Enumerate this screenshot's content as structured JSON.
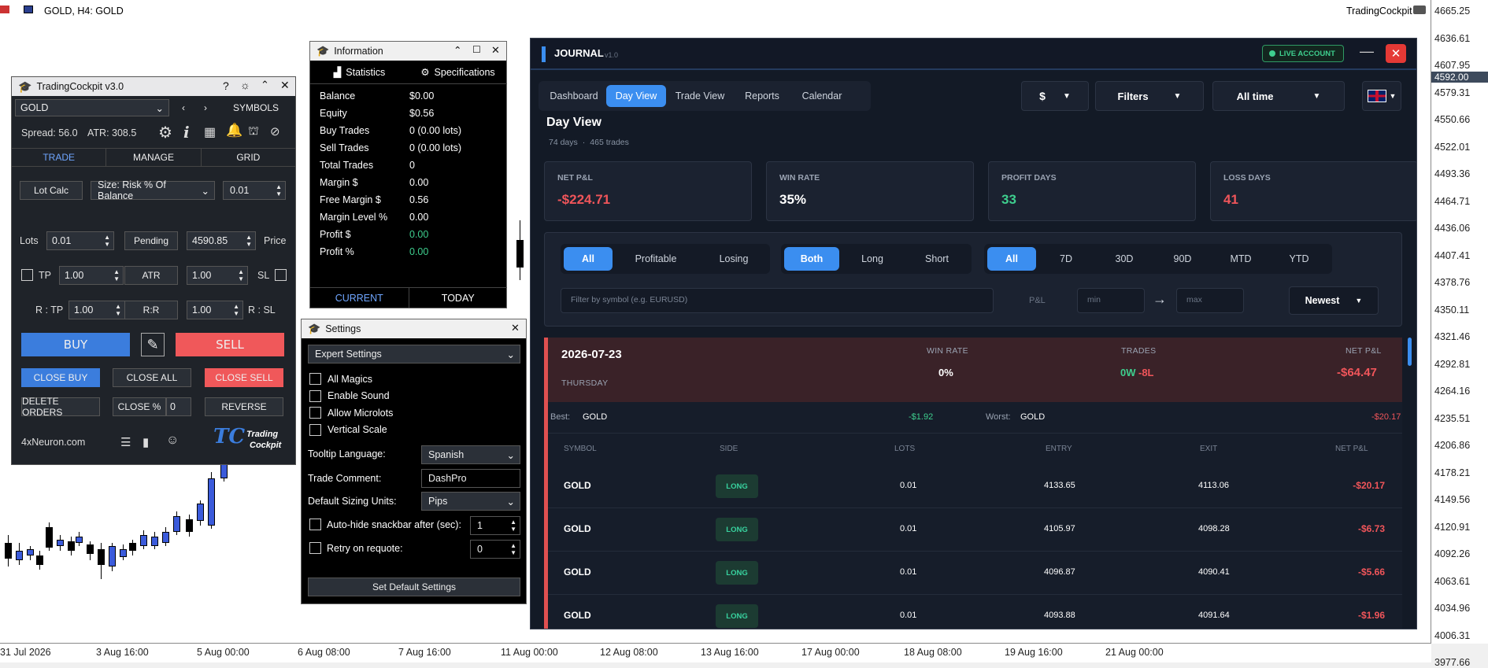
{
  "chart": {
    "symbol": "GOLD, H4:  GOLD",
    "brand": "TradingCockpit",
    "current_price": "4592.00",
    "price_ticks": [
      "4665.25",
      "4636.61",
      "4607.95",
      "4579.31",
      "4550.66",
      "4522.01",
      "4493.36",
      "4464.71",
      "4436.06",
      "4407.41",
      "4378.76",
      "4350.11",
      "4321.46",
      "4292.81",
      "4264.16",
      "4235.51",
      "4206.86",
      "4178.21",
      "4149.56",
      "4120.91",
      "4092.26",
      "4063.61",
      "4034.96",
      "4006.31",
      "3977.66"
    ],
    "time_ticks": [
      "31 Jul 2026",
      "3 Aug 16:00",
      "5 Aug 00:00",
      "6 Aug 08:00",
      "7 Aug 16:00",
      "11 Aug 00:00",
      "12 Aug 08:00",
      "13 Aug 16:00",
      "17 Aug 00:00",
      "18 Aug 08:00",
      "19 Aug 16:00",
      "21 Aug 00:00"
    ]
  },
  "tc": {
    "title": "TradingCockpit v3.0",
    "symbol": "GOLD",
    "symbols_btn": "SYMBOLS",
    "spread": "Spread: 56.0",
    "atr": "ATR: 308.5",
    "tabs": [
      "TRADE",
      "MANAGE",
      "GRID"
    ],
    "lot_calc": "Lot Calc",
    "size_mode": "Size: Risk % Of Balance",
    "size_val": "0.01",
    "lots_label": "Lots",
    "lots_val": "0.01",
    "pending": "Pending",
    "price_val": "4590.85",
    "price_label": "Price",
    "tp_label": "TP",
    "tp_val": "1.00",
    "atr_btn": "ATR",
    "sl_val": "1.00",
    "sl_label": "SL",
    "rtp_label": "R : TP",
    "rtp_val": "1.00",
    "rr_btn": "R:R",
    "rsl_val": "1.00",
    "rsl_label": "R : SL",
    "buy": "BUY",
    "sell": "SELL",
    "close_buy": "CLOSE BUY",
    "close_all": "CLOSE ALL",
    "close_sell": "CLOSE SELL",
    "delete_orders": "DELETE ORDERS",
    "close_pct": "CLOSE %",
    "close_pct_val": "0",
    "reverse": "REVERSE",
    "site": "4xNeuron.com",
    "logo_top": "Trading",
    "logo_bottom": "Cockpit",
    "colors": {
      "buy": "#3b7ddd",
      "sell": "#f0585a"
    }
  },
  "info": {
    "title": "Information",
    "tab_stats": "Statistics",
    "tab_specs": "Specifications",
    "rows": [
      {
        "k": "Balance",
        "v": "$0.00"
      },
      {
        "k": "Equity",
        "v": "$0.56"
      },
      {
        "k": "Buy Trades",
        "v": "0  (0.00 lots)"
      },
      {
        "k": "Sell Trades",
        "v": "0  (0.00 lots)"
      },
      {
        "k": "Total Trades",
        "v": "0"
      },
      {
        "k": "Margin $",
        "v": "0.00"
      },
      {
        "k": "Free Margin $",
        "v": "0.56"
      },
      {
        "k": "Margin Level %",
        "v": "0.00"
      },
      {
        "k": "Profit $",
        "v": "0.00"
      },
      {
        "k": "Profit %",
        "v": "0.00"
      }
    ],
    "current": "CURRENT",
    "today": "TODAY"
  },
  "settings": {
    "title": "Settings",
    "dropdown": "Expert Settings",
    "checks": [
      "All Magics",
      "Enable Sound",
      "Allow Microlots",
      "Vertical Scale"
    ],
    "tooltip_label": "Tooltip Language:",
    "tooltip_val": "Spanish",
    "comment_label": "Trade Comment:",
    "comment_val": "DashPro",
    "units_label": "Default Sizing Units:",
    "units_val": "Pips",
    "autohide_label": "Auto-hide snackbar after (sec):",
    "autohide_val": "1",
    "retry_label": "Retry on requote:",
    "retry_val": "0",
    "default_btn": "Set Default Settings"
  },
  "journal": {
    "title": "JOURNAL",
    "version": "v1.0",
    "live": "LIVE ACCOUNT",
    "nav": [
      "Dashboard",
      "Day View",
      "Trade View",
      "Reports",
      "Calendar"
    ],
    "currency": "$",
    "filters": "Filters",
    "period": "All time",
    "heading": "Day View",
    "sub_days": "74 days",
    "sub_sep": "·",
    "sub_trades": "465 trades",
    "kpis": [
      {
        "label": "NET P&L",
        "value": "-$224.71",
        "color": "#f0555a"
      },
      {
        "label": "WIN RATE",
        "value": "35%",
        "color": "#ffffff"
      },
      {
        "label": "PROFIT DAYS",
        "value": "33",
        "color": "#3ecf8e"
      },
      {
        "label": "LOSS DAYS",
        "value": "41",
        "color": "#f0555a"
      }
    ],
    "filter_result": [
      "All",
      "Profitable",
      "Losing"
    ],
    "filter_side": [
      "Both",
      "Long",
      "Short"
    ],
    "filter_range": [
      "All",
      "7D",
      "30D",
      "90D",
      "MTD",
      "YTD"
    ],
    "symbol_placeholder": "Filter by symbol (e.g. EURUSD)",
    "pnl_label": "P&L",
    "min_placeholder": "min",
    "max_placeholder": "max",
    "sort": "Newest",
    "day": {
      "date": "2026-07-23",
      "weekday": "THURSDAY",
      "winrate_label": "WIN RATE",
      "winrate": "0%",
      "trades_label": "TRADES",
      "wins": "0W",
      "losses": "-8L",
      "net_label": "NET P&L",
      "net": "-$64.47",
      "best_label": "Best:",
      "best_sym": "GOLD",
      "best_val": "-$1.92",
      "worst_label": "Worst:",
      "worst_sym": "GOLD",
      "worst_val": "-$20.17"
    },
    "columns": [
      "SYMBOL",
      "SIDE",
      "LOTS",
      "ENTRY",
      "EXIT",
      "NET P&L"
    ],
    "trades": [
      {
        "symbol": "GOLD",
        "side": "LONG",
        "lots": "0.01",
        "entry": "4133.65",
        "exit": "4113.06",
        "pnl": "-$20.17"
      },
      {
        "symbol": "GOLD",
        "side": "LONG",
        "lots": "0.01",
        "entry": "4105.97",
        "exit": "4098.28",
        "pnl": "-$6.73"
      },
      {
        "symbol": "GOLD",
        "side": "LONG",
        "lots": "0.01",
        "entry": "4096.87",
        "exit": "4090.41",
        "pnl": "-$5.66"
      },
      {
        "symbol": "GOLD",
        "side": "LONG",
        "lots": "0.01",
        "entry": "4093.88",
        "exit": "4091.64",
        "pnl": "-$1.96"
      }
    ]
  }
}
